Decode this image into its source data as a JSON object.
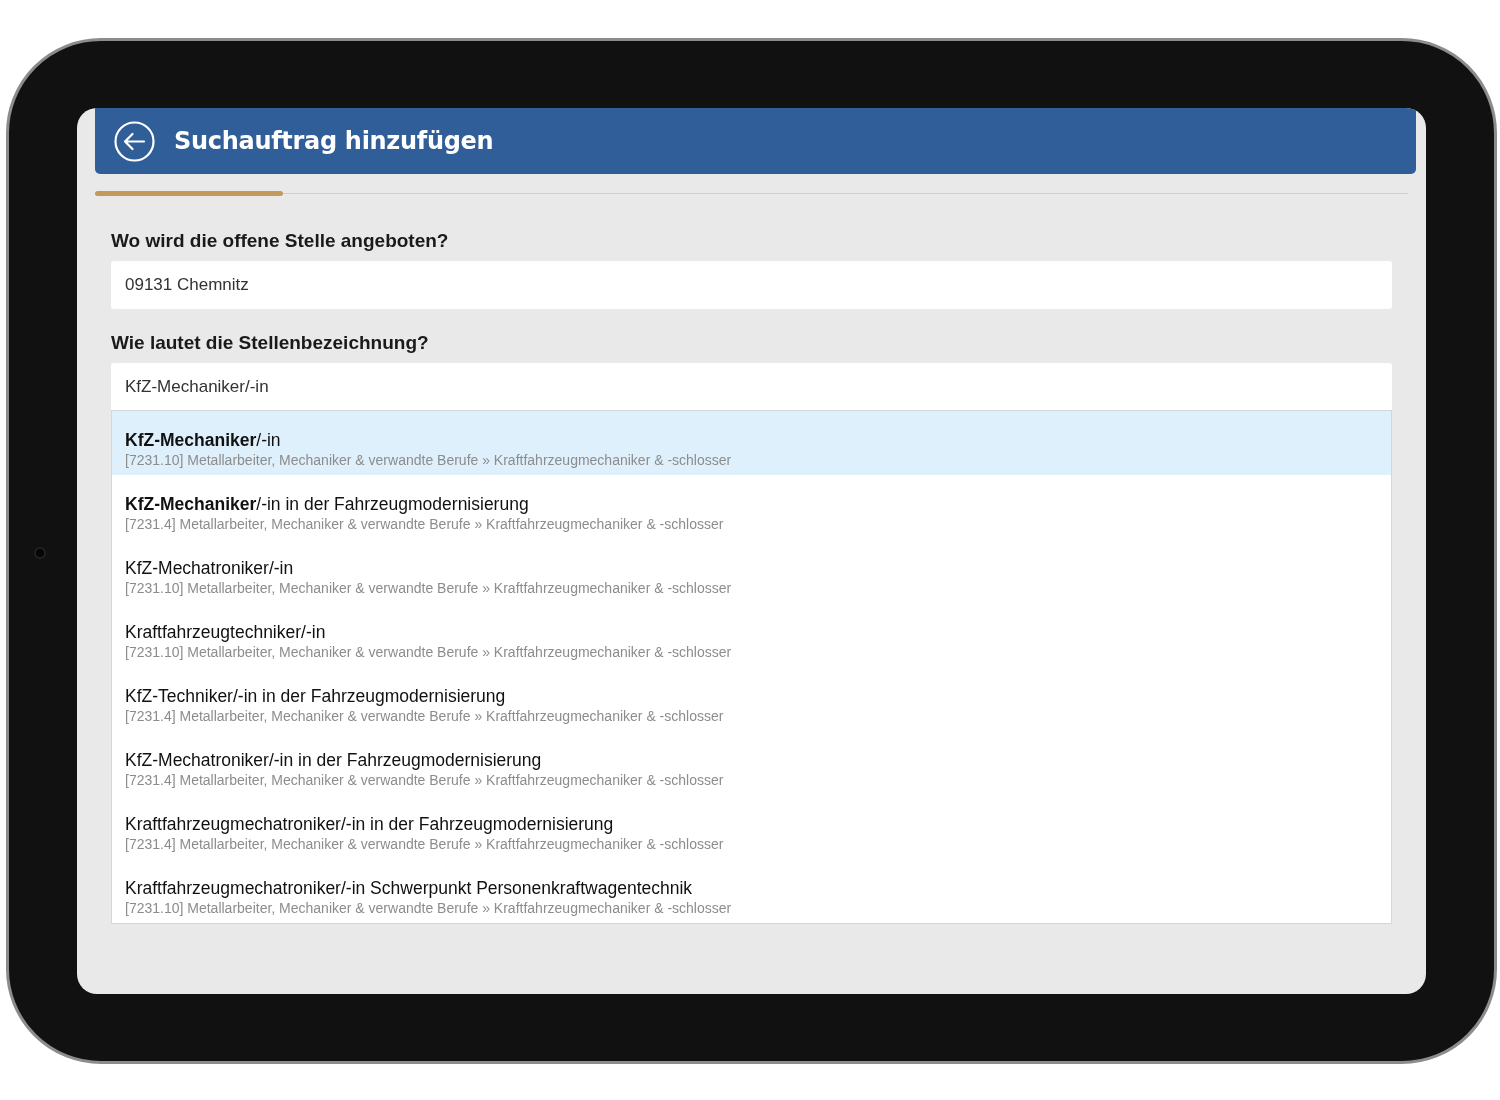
{
  "header": {
    "title": "Suchauftrag hinzufügen"
  },
  "progress": {
    "level": 0.143
  },
  "location": {
    "label": "Wo wird die offene Stelle angeboten?",
    "value": "09131 Chemnitz"
  },
  "job_title": {
    "label": "Wie lautet die Stellenbezeichnung?",
    "value": "KfZ-Mechaniker/-in"
  },
  "suggestions": [
    {
      "title": "**KfZ-Mechaniker**/-in",
      "category": "[7231.10] Metallarbeiter, Mechaniker & verwandte Berufe » Kraftfahrzeugmechaniker & -schlosser",
      "selected": true
    },
    {
      "title": "**KfZ-Mechaniker**/-in in der Fahrzeugmodernisierung",
      "category": "[7231.4] Metallarbeiter, Mechaniker & verwandte Berufe » Kraftfahrzeugmechaniker & -schlosser",
      "selected": false
    },
    {
      "title": "KfZ-Mechatroniker/-in",
      "category": "[7231.10] Metallarbeiter, Mechaniker & verwandte Berufe » Kraftfahrzeugmechaniker & -schlosser",
      "selected": false
    },
    {
      "title": "Kraftfahrzeugtechniker/-in",
      "category": "[7231.10] Metallarbeiter, Mechaniker & verwandte Berufe » Kraftfahrzeugmechaniker & -schlosser",
      "selected": false
    },
    {
      "title": "KfZ-Techniker/-in in der Fahrzeugmodernisierung",
      "category": "[7231.4] Metallarbeiter, Mechaniker & verwandte Berufe » Kraftfahrzeugmechaniker & -schlosser",
      "selected": false
    },
    {
      "title": "KfZ-Mechatroniker/-in in der Fahrzeugmodernisierung",
      "category": "[7231.4] Metallarbeiter, Mechaniker & verwandte Berufe » Kraftfahrzeugmechaniker & -schlosser",
      "selected": false
    },
    {
      "title": "Kraftfahrzeugmechatroniker/-in in der Fahrzeugmodernisierung",
      "category": "[7231.4] Metallarbeiter, Mechaniker & verwandte Berufe » Kraftfahrzeugmechaniker & -schlosser",
      "selected": false
    },
    {
      "title": "Kraftfahrzeugmechatroniker/-in Schwerpunkt Personenkraftwagentechnik",
      "category": "[7231.10] Metallarbeiter, Mechaniker & verwandte Berufe » Kraftfahrzeugmechaniker & -schlosser",
      "selected": false
    }
  ]
}
